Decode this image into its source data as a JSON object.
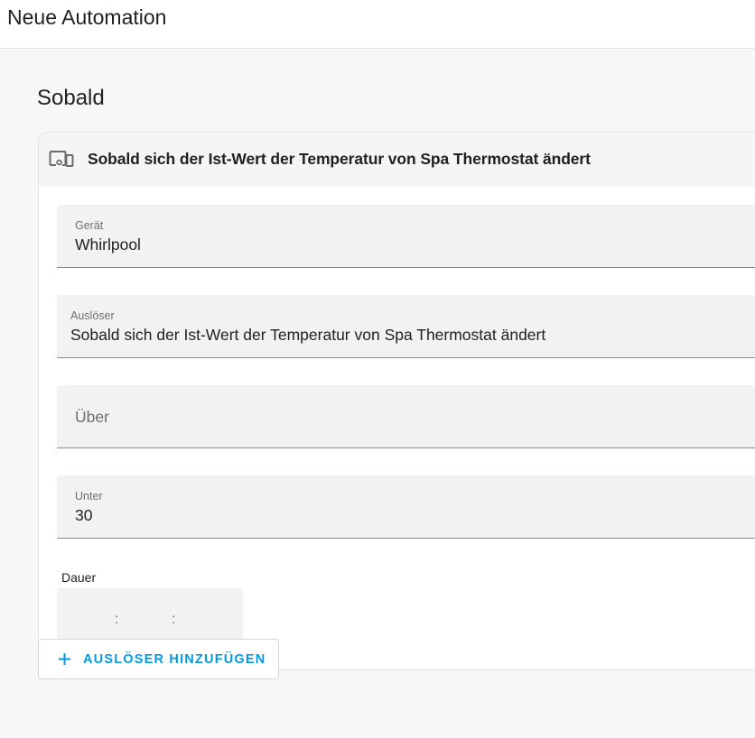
{
  "header": {
    "title": "Neue Automation"
  },
  "section": {
    "title": "Sobald"
  },
  "trigger_card": {
    "icon": "devices-icon",
    "title": "Sobald sich der Ist-Wert der Temperatur von Spa Thermostat ändert",
    "fields": {
      "device": {
        "label": "Gerät",
        "value": "Whirlpool"
      },
      "trigger": {
        "label": "Auslöser",
        "value": "Sobald sich der Ist-Wert der Temperatur von Spa Thermostat ändert"
      },
      "above": {
        "placeholder": "Über",
        "value": ""
      },
      "below": {
        "label": "Unter",
        "value": "30"
      }
    },
    "duration": {
      "label": "Dauer",
      "separator": ":",
      "hours": "",
      "minutes": "",
      "seconds": ""
    }
  },
  "add_trigger_button": {
    "icon": "plus-icon",
    "label": "AUSLÖSER HINZUFÜGEN"
  },
  "colors": {
    "accent": "#039be5",
    "field_bg": "#f2f2f2",
    "card_header_bg": "#f5f5f5"
  }
}
